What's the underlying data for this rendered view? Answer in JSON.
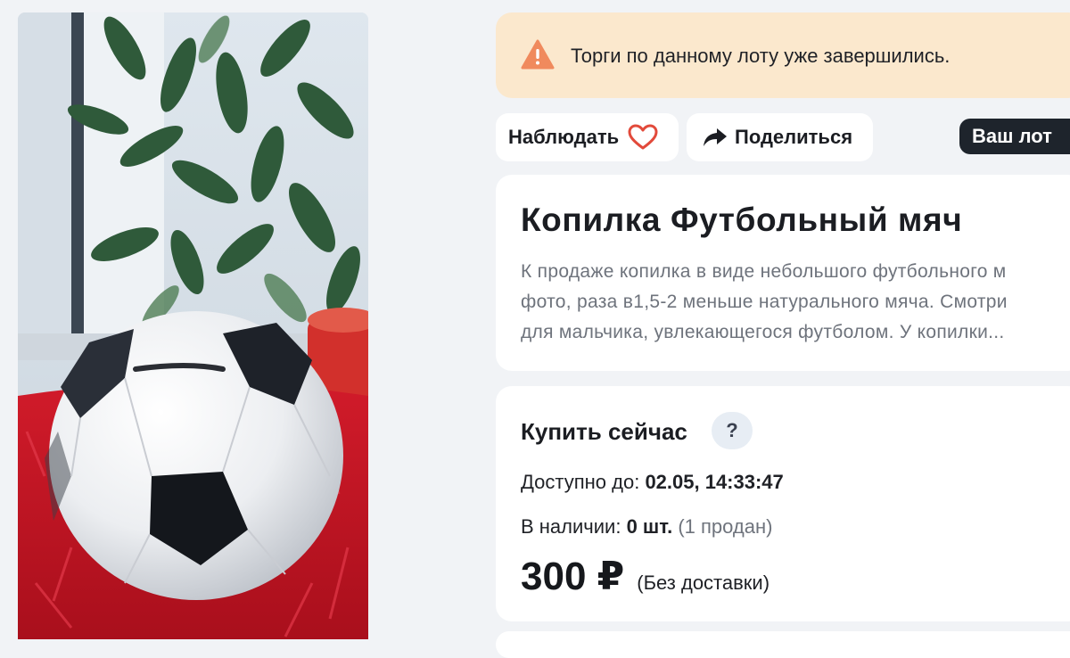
{
  "photo": {
    "subject": "soccer-ball-piggy-bank"
  },
  "alert": {
    "icon": "warning-icon",
    "text": "Торги по данному лоту уже завершились.",
    "color": "#fbe8cd"
  },
  "actions": {
    "watch_label": "Наблюдать",
    "watch_icon": "heart-icon",
    "share_label": "Поделиться",
    "share_icon": "share-arrow-icon",
    "own_badge": "Ваш лот"
  },
  "lot": {
    "title": "Копилка Футбольный мяч",
    "description_lines": [
      "К продаже копилка в виде небольшого футбольного м",
      "фото, раза в1,5-2 меньше натурального мяча. Смотри",
      "для мальчика, увлекающегося футболом. У копилки..."
    ]
  },
  "buy": {
    "title": "Купить сейчас",
    "help": "?",
    "available_label": "Доступно до:",
    "available_value": "02.05, 14:33:47",
    "stock_label": "В наличии:",
    "stock_value": "0 шт.",
    "sold_note": "(1 продан)",
    "price": "300 ₽",
    "delivery_note": "(Без доставки)"
  },
  "colors": {
    "page_bg": "#f1f3f6",
    "badge_bg": "#1e242c",
    "heart": "#e24a3b",
    "warning": "#f08a5d"
  }
}
